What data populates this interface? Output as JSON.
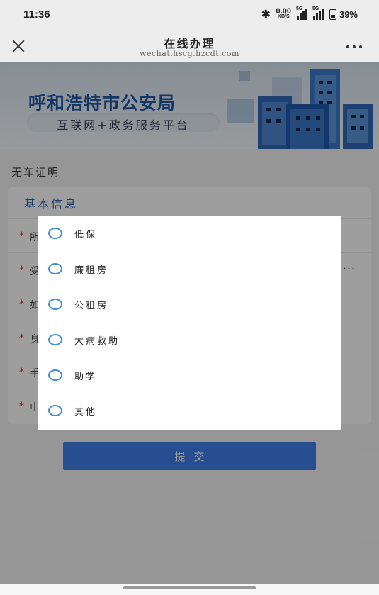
{
  "status_bar": {
    "time": "11:36",
    "bluetooth_icon": "bluetooth-icon",
    "net_speed_value": "0.00",
    "net_speed_unit": "KB/S",
    "signal_label_1": "5G",
    "signal_label_2": "5G",
    "battery_percent": "39%"
  },
  "nav": {
    "title": "在线办理",
    "url": "wechat.hscg.hzcdt.com",
    "close_icon": "close-icon",
    "more_icon": "more-icon"
  },
  "banner": {
    "title": "呼和浩特市公安局",
    "subtitle": "互联网+政务服务平台"
  },
  "page": {
    "section_title": "无车证明",
    "card_header": "基本信息",
    "rows": [
      {
        "required": "*",
        "label_partial": "所"
      },
      {
        "required": "*",
        "label_partial": "受",
        "trailing": "···"
      },
      {
        "required": "*",
        "label_partial": "如"
      },
      {
        "required": "*",
        "label_partial": "身"
      },
      {
        "required": "*",
        "label_partial": "手"
      },
      {
        "required": "*",
        "label_partial": "申"
      }
    ],
    "submit_label": "提交"
  },
  "dialog": {
    "options": [
      {
        "label": "低保",
        "selected": false
      },
      {
        "label": "廉租房",
        "selected": false
      },
      {
        "label": "公租房",
        "selected": false
      },
      {
        "label": "大病救助",
        "selected": false
      },
      {
        "label": "助学",
        "selected": false
      },
      {
        "label": "其他",
        "selected": false
      }
    ]
  },
  "colors": {
    "primary_blue": "#3f7ee8",
    "radio_blue": "#3d8ddc",
    "required_red": "#e02b2b",
    "banner_title": "#1f58a6"
  }
}
